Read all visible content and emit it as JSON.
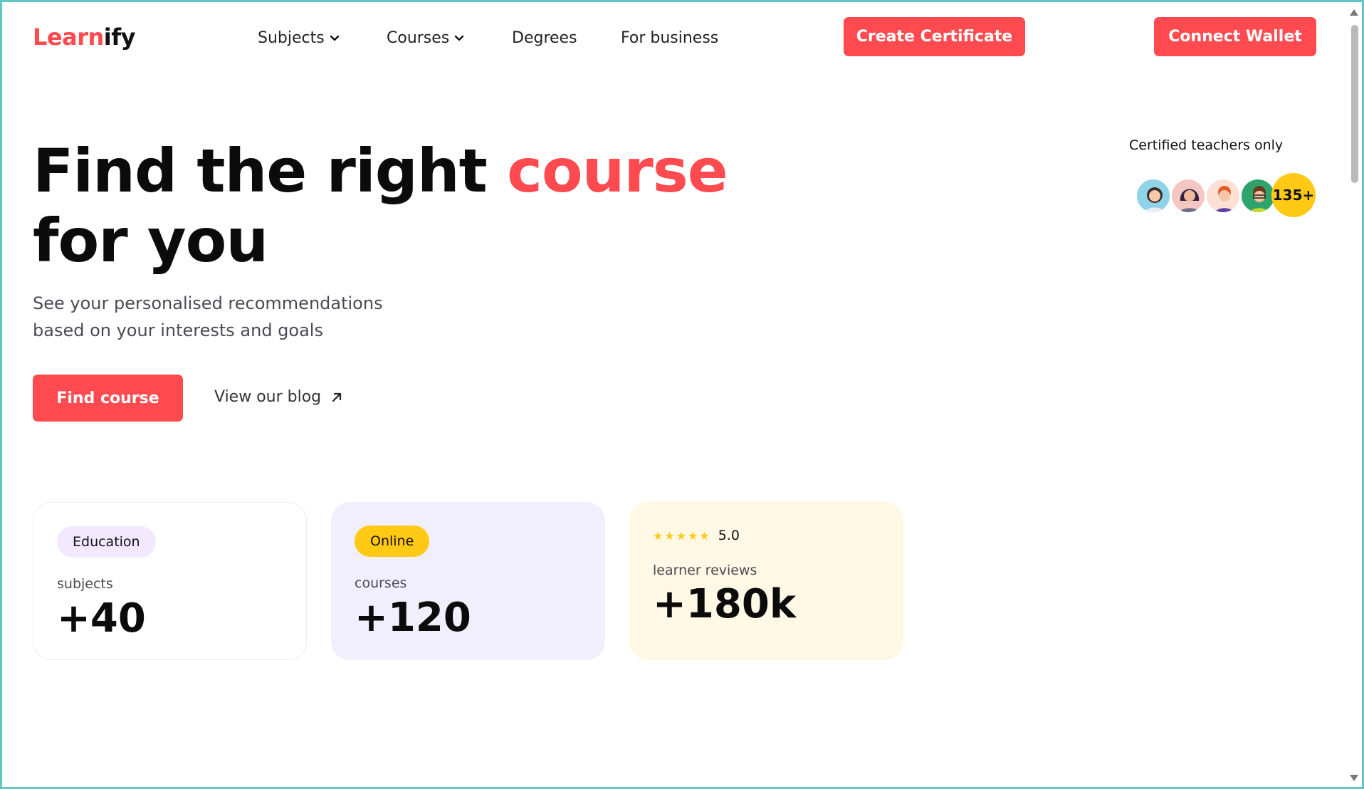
{
  "brand": {
    "logo_part1": "Learn",
    "logo_part2": "ify"
  },
  "nav": {
    "subjects": "Subjects",
    "courses": "Courses",
    "degrees": "Degrees",
    "for_business": "For business"
  },
  "header_buttons": {
    "create_certificate": "Create Certificate",
    "connect_wallet": "Connect Wallet"
  },
  "hero": {
    "title_part1": "Find the right",
    "title_accent": "course",
    "title_line2": "for you",
    "subtitle_line1": "See your personalised recommendations",
    "subtitle_line2": "based on your interests and goals",
    "cta": "Find course",
    "blog_link": "View our blog"
  },
  "teachers": {
    "label": "Certified teachers only",
    "count": "135+",
    "avatars": [
      "avatar-teacher-1",
      "avatar-teacher-2",
      "avatar-teacher-3",
      "avatar-teacher-4"
    ]
  },
  "stats": [
    {
      "badge": "Education",
      "label": "subjects",
      "value": "+40"
    },
    {
      "badge": "Online",
      "label": "courses",
      "value": "+120"
    },
    {
      "rating": "5.0",
      "stars": "★★★★★",
      "label": "learner reviews",
      "value": "+180k"
    }
  ],
  "colors": {
    "accent": "#ff4b4f",
    "yellow": "#ffc914",
    "lavender": "#f1effd",
    "cream": "#fff8e5",
    "pink_pill": "#f3e9ff"
  }
}
